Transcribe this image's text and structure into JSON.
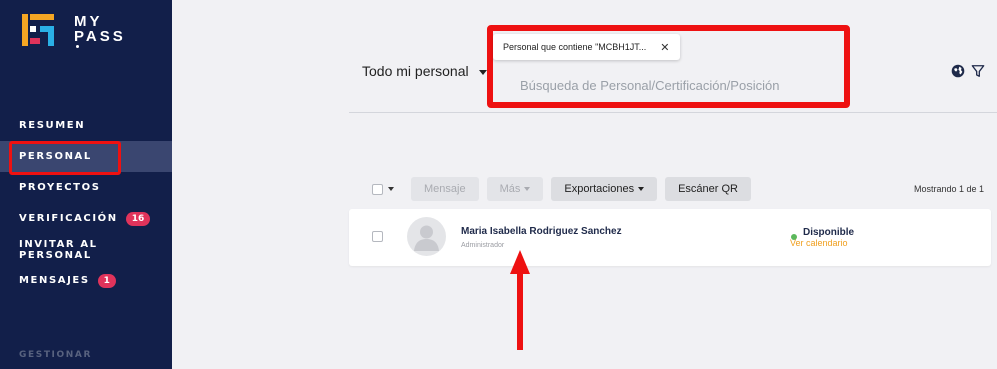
{
  "brand": {
    "line1": "MY",
    "line2": "PASS"
  },
  "nav": {
    "items": [
      {
        "label": "RESUMEN",
        "badge": ""
      },
      {
        "label": "PERSONAL",
        "badge": ""
      },
      {
        "label": "PROYECTOS",
        "badge": ""
      },
      {
        "label": "VERIFICACIÓN",
        "badge": "16"
      },
      {
        "label": "INVITAR AL PERSONAL",
        "badge": ""
      },
      {
        "label": "MENSAJES",
        "badge": "1"
      }
    ],
    "active": "PERSONAL",
    "section_label": "GESTIONAR"
  },
  "filter": {
    "scope_label": "Todo mi personal",
    "chip_label": "Personal que contiene \"MCBH1JT...",
    "search_placeholder": "Búsqueda de Personal/Certificación/Posición"
  },
  "toolbar": {
    "message_label": "Mensaje",
    "more_label": "Más",
    "export_label": "Exportaciones",
    "qr_label": "Escáner QR",
    "count_text": "Mostrando 1 de 1"
  },
  "people": [
    {
      "name": "Maria Isabella Rodriguez Sanchez",
      "role": "Administrador",
      "status": "Disponible",
      "calendar_link": "Ver calendario"
    }
  ],
  "colors": {
    "sidebar_bg": "#121f4a",
    "highlight": "#ee1111",
    "badge": "#e0335b",
    "status_green": "#5cb85c",
    "link_orange": "#f0a020"
  },
  "icons": [
    "globe-icon",
    "filter-icon",
    "close-icon",
    "chevron-down-icon",
    "avatar-icon",
    "arrow-up-icon"
  ]
}
